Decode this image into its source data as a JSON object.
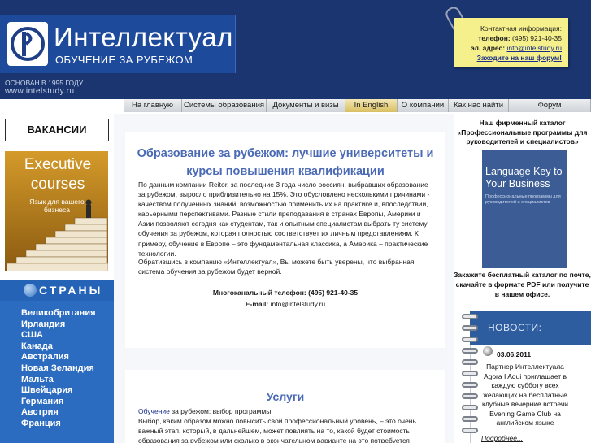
{
  "header": {
    "brand_name": "Интеллектуал",
    "brand_sub": "ОБУЧЕНИЕ ЗА РУБЕЖОМ",
    "founded": "ОСНОВАН В 1995 ГОДУ",
    "site_url": "www.intelstudy.ru"
  },
  "contact": {
    "heading": "Контактная информация:",
    "phone_label": "телефон:",
    "phone": "(495) 921-40-35",
    "email_label": "эл. адрес:",
    "email": "info@intelstudy.ru",
    "forum_link": "Заходите на наш форум!"
  },
  "nav": {
    "items": [
      {
        "label": "На главную"
      },
      {
        "label": "Системы образования"
      },
      {
        "label": "Документы и визы"
      },
      {
        "label": "In English"
      },
      {
        "label": "О компании"
      },
      {
        "label": "Как нас найти"
      },
      {
        "label": "Форум"
      }
    ]
  },
  "sidebar": {
    "vacancies": "ВАКАНСИИ",
    "banner_title": "Executive courses",
    "banner_sub": "Язык для вашего бизнеса",
    "countries_title": "СТРАНЫ",
    "countries": [
      "Великобритания",
      "Ирландия",
      "США",
      "Канада",
      "Австралия",
      "Новая Зеландия",
      "Мальта",
      "Швейцария",
      "Германия",
      "Австрия",
      "Франция"
    ]
  },
  "main": {
    "title": "Образование за рубежом: лучшие университеты и курсы повышения квалификации",
    "para1": "По данным компании Reitor, за последние 3 года число россиян, выбравших образование за рубежом, выросло приблизительно на 15%. Это обусловлено несколькими причинами - качеством полученных знаний, возможностью применить их на практике и, впоследствии, карьерными перспективами. Разные стили преподавания в странах Европы, Америки и Азии позволяют сегодня как студентам, так и опытным специалистам выбрать ту систему обучения за рубежом, которая полностью соответствует их личным представлениям. К примеру, обучение в Европе – это фундаментальная классика, а Америка – практические технологии.",
    "para2": "Обратившись в компанию «Интеллектуал», Вы можете быть уверены, что выбранная система обучения за рубежом будет верной.",
    "phone_label": "Многоканальный телефон:",
    "phone": "(495) 921-40-35",
    "email_label": "E-mail:",
    "email": "info@intelstudy.ru",
    "services_title": "Услуги",
    "services_link": "Обучение",
    "services_line1": " за рубежом: выбор программы",
    "services_text": "Выбор, каким образом можно повысить свой профессиональный уровень, – это очень важный этап, который, в дальнейшем, может повлиять на то, какой будет стоимость образования за рубежом или сколько в окончательном варианте на это потребуется времени. Необходимо"
  },
  "right": {
    "catalog_title": "Наш фирменный каталог «Профессиональные программы для руководителей и специалистов»",
    "book_title": "Language Key to Your Business",
    "book_sub": "Профессиональные программы для руководителей и специалистов",
    "catalog_text": "Закажите бесплатный каталог по почте, скачайте в формате PDF или получите в нашем офисе.",
    "news_title": "НОВОСТИ:",
    "news_date": "03.06.2011",
    "news_text": "Партнер Интеллектуала Agora I Aqui приглашает в каждую субботу всех желающих на бесплатные клубные вечерние встречи Evening Game Club на английском языке",
    "news_more": "Подробнее..."
  },
  "colors": {
    "header_bg": "#1a3570",
    "accent_blue": "#4b6ab5",
    "countries_bg": "#2c6cc0",
    "note_bg": "#f5f08c"
  }
}
